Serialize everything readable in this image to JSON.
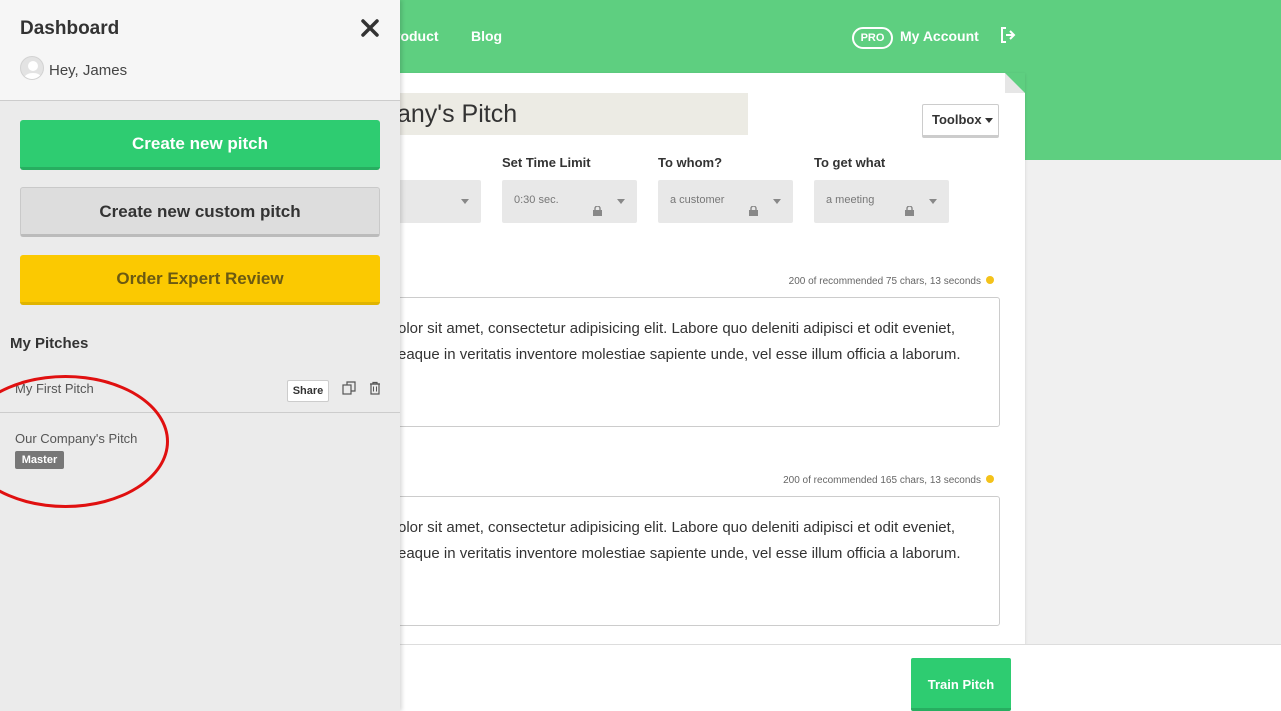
{
  "header": {
    "nav": [
      "roduct",
      "Blog"
    ],
    "pro_badge": "PRO",
    "account_label": "My Account",
    "colors": {
      "header_green": "#5ecf80",
      "button_green": "#2ecc71",
      "button_yellow": "#fbc901"
    }
  },
  "card": {
    "title": "any's Pitch",
    "toolbox_label": "Toolbox",
    "fields": [
      {
        "label": "",
        "value": ""
      },
      {
        "label": "Set Time Limit",
        "value": "0:30 sec."
      },
      {
        "label": "To whom?",
        "value": "a customer"
      },
      {
        "label": "To get what",
        "value": "a meeting"
      }
    ],
    "sections": [
      {
        "stats": "200 of recommended 75 chars, 13 seconds",
        "line1": "olor sit amet, consectetur adipisicing elit. Labore quo deleniti adipisci et odit eveniet,",
        "line2": "eaque in veritatis inventore molestiae sapiente unde, vel esse illum officia a laborum."
      },
      {
        "stats": "200 of recommended 165 chars, 13 seconds",
        "line1": "olor sit amet, consectetur adipisicing elit. Labore quo deleniti adipisci et odit eveniet,",
        "line2": "eaque in veritatis inventore molestiae sapiente unde, vel esse illum officia a laborum."
      }
    ]
  },
  "footer": {
    "train_label": "Train Pitch"
  },
  "sidebar": {
    "title": "Dashboard",
    "greeting": "Hey, James",
    "buttons": {
      "create": "Create new pitch",
      "custom": "Create new custom pitch",
      "review": "Order Expert Review"
    },
    "section_title": "My Pitches",
    "pitches": [
      {
        "name": "My First Pitch",
        "share_label": "Share"
      },
      {
        "name": "Our Company's Pitch",
        "badge": "Master"
      }
    ]
  }
}
